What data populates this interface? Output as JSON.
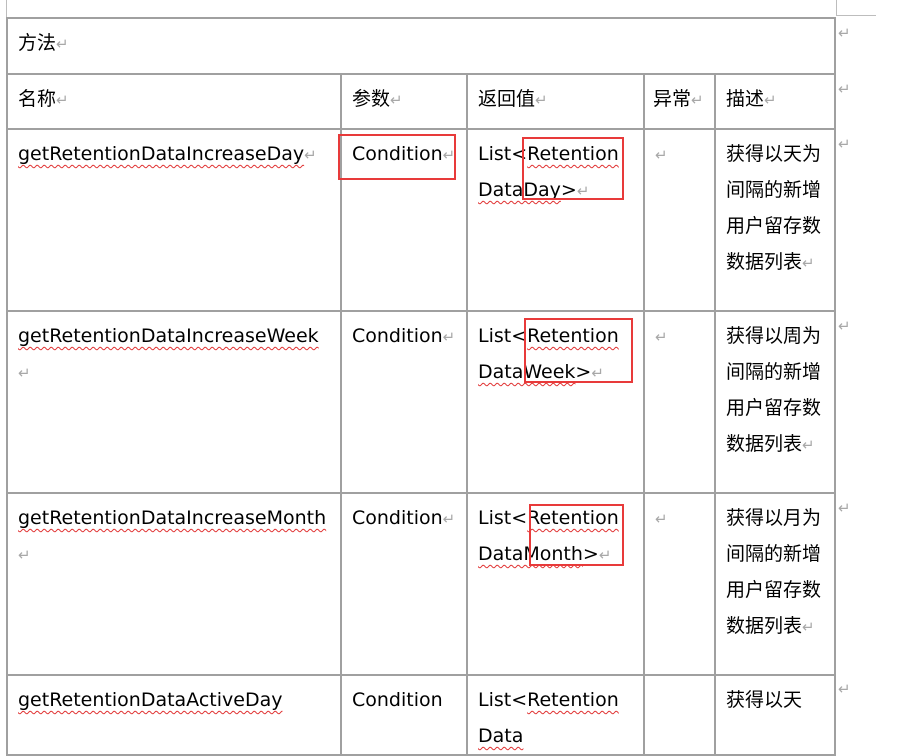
{
  "document": {
    "section_title": "方法",
    "paragraph_mark": "↵",
    "columns": [
      "名称",
      "参数",
      "返回值",
      "异常",
      "描述"
    ],
    "rows": [
      {
        "name": "getRetentionDataIncreaseDay",
        "param": "Condition",
        "return_prefix": "List<",
        "return_type": "RetentionDataDay",
        "return_suffix": ">",
        "exception": "",
        "description": "获得以天为间隔的新增用户留存数数据列表"
      },
      {
        "name": "getRetentionDataIncreaseWeek",
        "param": "Condition",
        "return_prefix": "List<",
        "return_type": "RetentionDataWeek",
        "return_suffix": ">",
        "exception": "",
        "description": "获得以周为间隔的新增用户留存数数据列表"
      },
      {
        "name": "getRetentionDataIncreaseMonth",
        "param": "Condition",
        "return_prefix": "List<",
        "return_type": "RetentionDataMonth",
        "return_suffix": ">",
        "exception": "",
        "description": "获得以月为间隔的新增用户留存数数据列表"
      },
      {
        "name": "getRetentionDataActiveDay",
        "param": "Condition",
        "return_prefix": "List<",
        "return_type": "RetentionData",
        "return_suffix": "",
        "exception": "",
        "description": "获得以天"
      }
    ]
  },
  "annotation_color": "#e83a3a"
}
